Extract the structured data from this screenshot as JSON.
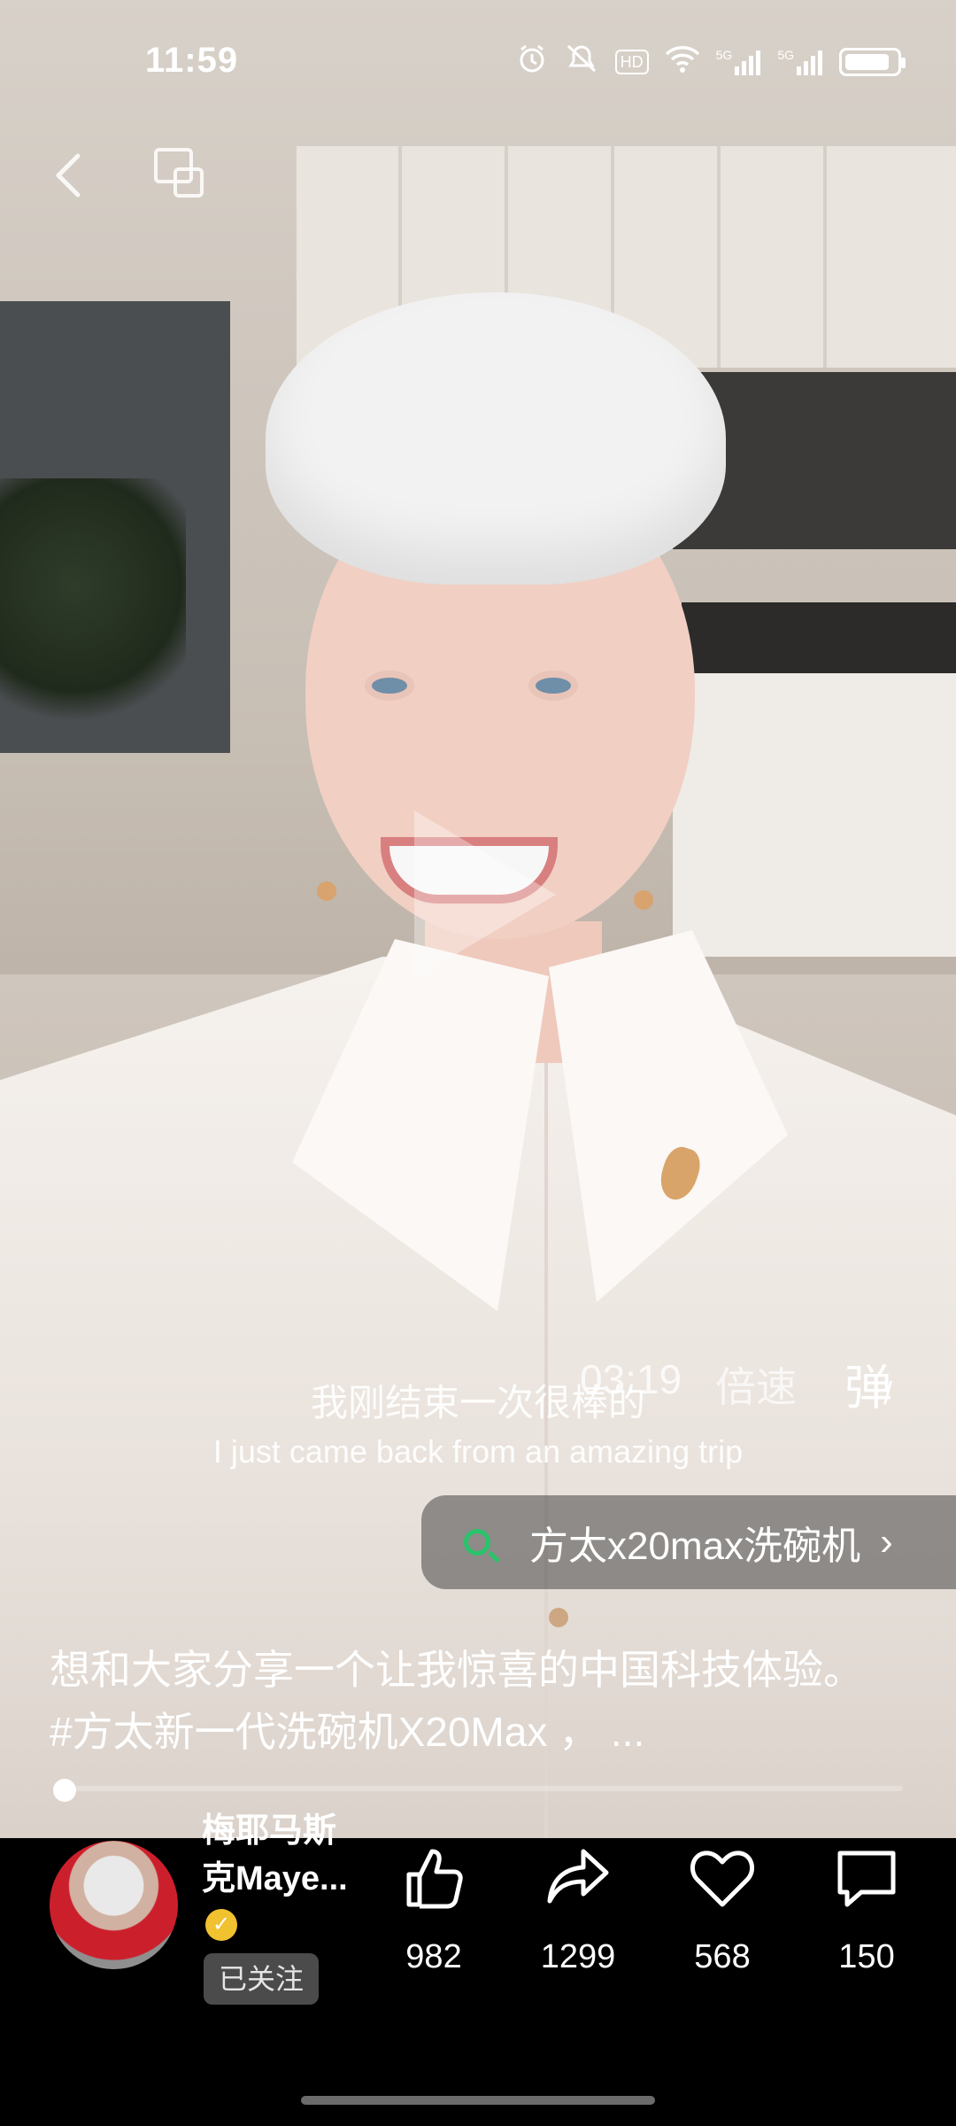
{
  "status_bar": {
    "time": "11:59",
    "icons": [
      "alarm-icon",
      "mute-icon",
      "hd-icon",
      "wifi-icon",
      "signal-5g-icon",
      "signal-5g-icon",
      "battery-icon"
    ],
    "hd_label": "HD",
    "sig1": "5G",
    "sig2": "5G",
    "battery_level": 0.85
  },
  "top_controls": {
    "back_icon": "back-arrow-icon",
    "cast_icon": "screen-cast-icon"
  },
  "player": {
    "time": "03:19",
    "speed_label": "倍速",
    "danmu_label": "弹",
    "subtitle_zh": "我刚结束一次很棒的",
    "subtitle_en": "I just came back from an amazing trip",
    "progress": 0.0
  },
  "search_suggestion": {
    "label": "方太x20max洗碗机",
    "chevron": "›"
  },
  "description": {
    "line1": "想和大家分享一个让我惊喜的中国科技体验。",
    "line2": "#方太新一代洗碗机X20Max ， ..."
  },
  "author": {
    "name": "梅耶马斯克Maye...",
    "verified_mark": "✓",
    "follow_label": "已关注"
  },
  "actions": {
    "like_count": "982",
    "share_count": "1299",
    "favorite_count": "568",
    "comment_count": "150"
  }
}
